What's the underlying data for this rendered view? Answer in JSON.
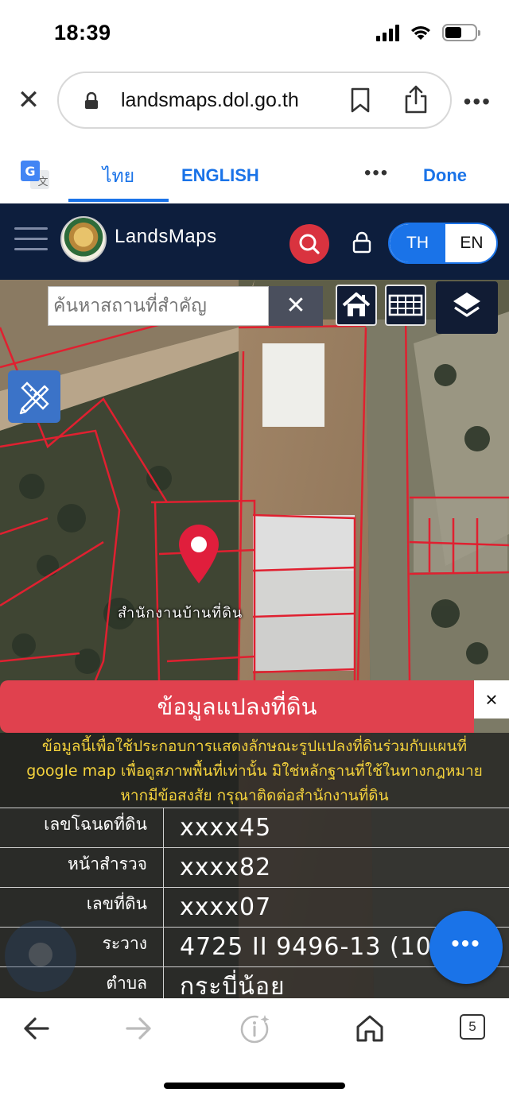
{
  "status_bar": {
    "time": "18:39"
  },
  "browser": {
    "url": "landsmaps.dol.go.th"
  },
  "translate_bar": {
    "tab_thai": "ไทย",
    "tab_english": "ENGLISH",
    "more": "•••",
    "done": "Done"
  },
  "header": {
    "brand": "LandsMaps",
    "lang_th": "TH",
    "lang_en": "EN"
  },
  "map": {
    "search_placeholder": "ค้นหาสถานที่สำคัญ",
    "pin_label": "สำนักงานบ้านที่ดิน"
  },
  "panel": {
    "title": "ข้อมูลแปลงที่ดิน",
    "close": "×",
    "disclaimer_lines": [
      "ข้อมูลนี้เพื่อใช้ประกอบการแสดงลักษณะรูปแปลงที่ดินร่วมกับแผนที่",
      "google map เพื่อดูสภาพพื้นที่เท่านั้น มิใช่หลักฐานที่ใช้ในทางกฎหมาย",
      "หากมีข้อสงสัย กรุณาติดต่อสำนักงานที่ดิน"
    ],
    "rows": [
      {
        "label": "เลขโฉนดที่ดิน",
        "value": "xxxx45"
      },
      {
        "label": "หน้าสำรวจ",
        "value": "xxxx82"
      },
      {
        "label": "เลขที่ดิน",
        "value": "xxxx07"
      },
      {
        "label": "ระวาง",
        "value": "4725 II 9496-13 (1000)"
      },
      {
        "label": "ตำบล",
        "value": "กระบี่น้อย"
      }
    ],
    "fab_label": "•••"
  },
  "toolbar": {
    "tabs_count": "5"
  },
  "colors": {
    "header_bg": "#0d1e3d",
    "accent_blue": "#1a73e8",
    "panel_red": "#e0414e",
    "parcel_line": "#e02030",
    "disclaimer_text": "#f4d23c"
  }
}
